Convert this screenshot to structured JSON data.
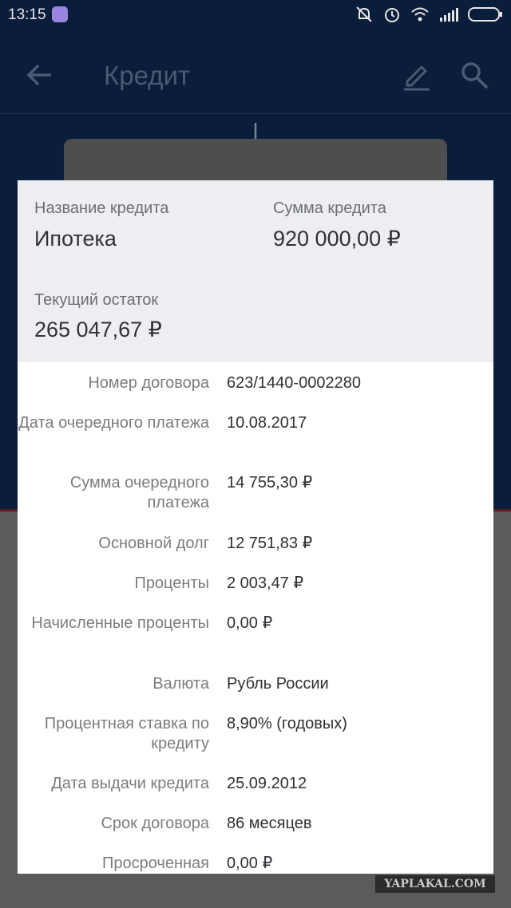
{
  "status_bar": {
    "time": "13:15",
    "icons": [
      "app-icon",
      "mute-icon",
      "alarm-icon",
      "wifi-icon",
      "signal-icon",
      "battery-icon"
    ]
  },
  "app_bar": {
    "title": "Кредит",
    "icons": [
      "back-arrow-icon",
      "edit-icon",
      "search-icon"
    ]
  },
  "dialog": {
    "header": {
      "name_label": "Название кредита",
      "name_value": "Ипотека",
      "amount_label": "Сумма кредита",
      "amount_value": "920 000,00 ₽",
      "balance_label": "Текущий остаток",
      "balance_value": "265 047,67 ₽"
    },
    "rows": [
      {
        "label": "Номер договора",
        "value": "623/1440-0002280"
      },
      {
        "label": "Дата очередного платежа",
        "value": "10.08.2017"
      },
      {
        "label": "Сумма очередного платежа",
        "value": "14 755,30 ₽"
      },
      {
        "label": "Основной долг",
        "value": "12 751,83 ₽"
      },
      {
        "label": "Проценты",
        "value": "2 003,47 ₽"
      },
      {
        "label": "Начисленные проценты",
        "value": "0,00 ₽"
      },
      {
        "label": "Валюта",
        "value": "Рубль России"
      },
      {
        "label": "Процентная ставка по кредиту",
        "value": "8,90% (годовых)"
      },
      {
        "label": "Дата выдачи кредита",
        "value": "25.09.2012"
      },
      {
        "label": "Срок договора",
        "value": "86 месяцев"
      },
      {
        "label": "Просроченная",
        "value": "0,00 ₽"
      }
    ]
  },
  "watermark": "YAPLAKAL.COM",
  "colors": {
    "app_bar_dimmed": "#0a1d3b",
    "dialog_header_bg": "#eceef2",
    "label_text": "#7a7c80",
    "value_text": "#2e3034"
  }
}
